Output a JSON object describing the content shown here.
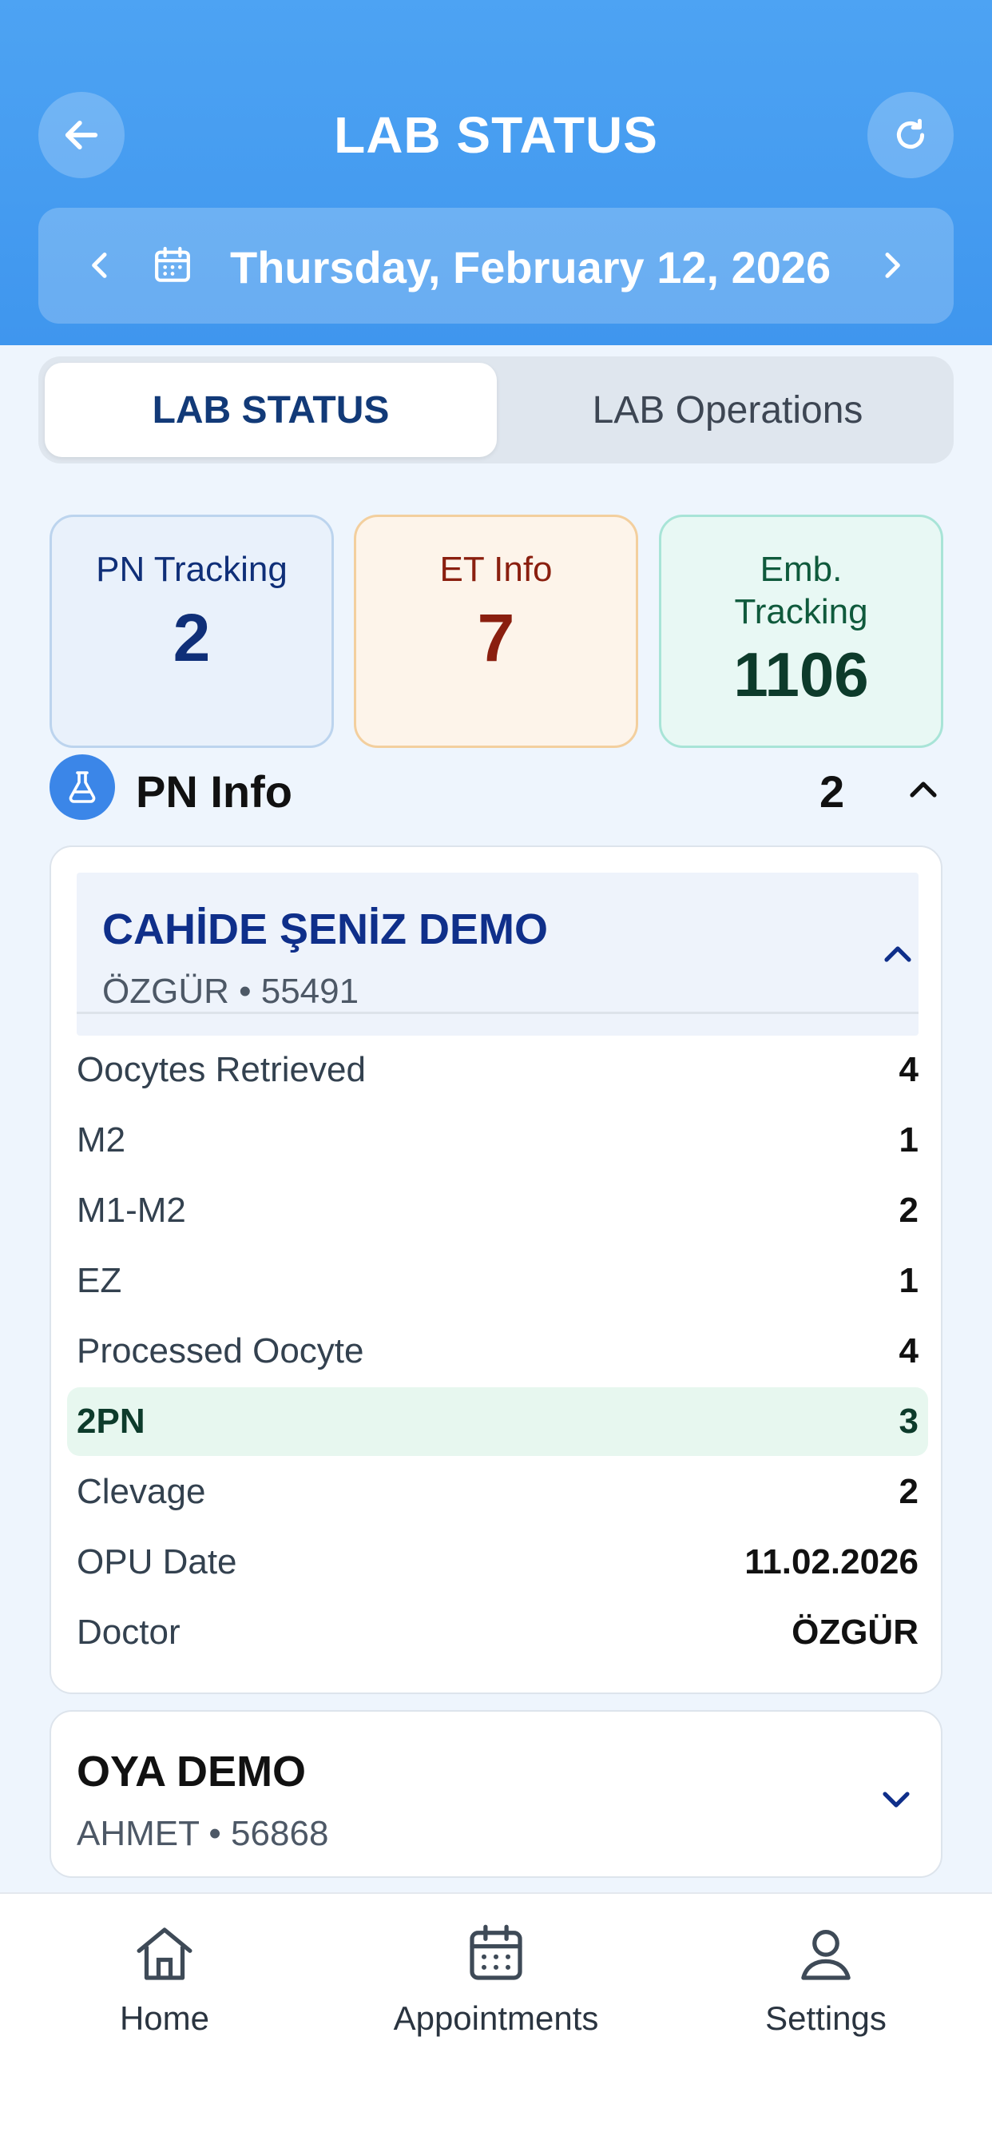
{
  "header": {
    "title": "LAB STATUS",
    "date": "Thursday, February 12, 2026"
  },
  "tabs": [
    {
      "label": "LAB STATUS",
      "active": true
    },
    {
      "label": "LAB Operations",
      "active": false
    }
  ],
  "stats": {
    "pn": {
      "label": "PN Tracking",
      "value": "2"
    },
    "et": {
      "label": "ET Info",
      "value": "7"
    },
    "emb": {
      "label_line1": "Emb.",
      "label_line2": "Tracking",
      "value": "1106"
    }
  },
  "section": {
    "title": "PN Info",
    "count": "2",
    "icon": "flask-icon"
  },
  "patients": [
    {
      "name": "CAHİDE ŞENİZ DEMO",
      "sub": "ÖZGÜR • 55491",
      "expanded": true,
      "rows": [
        {
          "k": "Oocytes Retrieved",
          "v": "4"
        },
        {
          "k": "M2",
          "v": "1"
        },
        {
          "k": "M1-M2",
          "v": "2"
        },
        {
          "k": "EZ",
          "v": "1"
        },
        {
          "k": "Processed Oocyte",
          "v": "4"
        },
        {
          "k": "2PN",
          "v": "3"
        },
        {
          "k": "Clevage",
          "v": "2"
        },
        {
          "k": "OPU Date",
          "v": "11.02.2026"
        },
        {
          "k": "Doctor",
          "v": "ÖZGÜR"
        }
      ]
    },
    {
      "name": "OYA DEMO",
      "sub": "AHMET • 56868",
      "expanded": false
    }
  ],
  "nav": [
    {
      "label": "Home",
      "icon": "home-icon"
    },
    {
      "label": "Appointments",
      "icon": "calendar-icon"
    },
    {
      "label": "Settings",
      "icon": "user-icon"
    }
  ],
  "colors": {
    "header": "#4da3f3",
    "pn_text": "#0f2f78",
    "et_text": "#8a1f0f",
    "emb_text": "#0d3b2b",
    "highlight_row": "#e7f7ef"
  }
}
